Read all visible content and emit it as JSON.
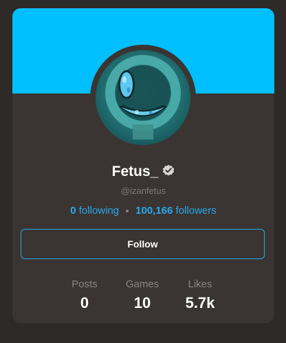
{
  "profile": {
    "display_name": "Fetus_",
    "handle": "@izanfetus",
    "verified_icon": "verified-badge-icon",
    "following_count": "0",
    "following_label": "following",
    "followers_count": "100,166",
    "followers_label": "followers"
  },
  "actions": {
    "follow_label": "Follow"
  },
  "stats": [
    {
      "label": "Posts",
      "value": "0"
    },
    {
      "label": "Games",
      "value": "10"
    },
    {
      "label": "Likes",
      "value": "5.7k"
    }
  ],
  "colors": {
    "banner": "#00bfff",
    "accent": "#2aa8ee",
    "card": "#3a3532",
    "background": "#2d2a27"
  }
}
